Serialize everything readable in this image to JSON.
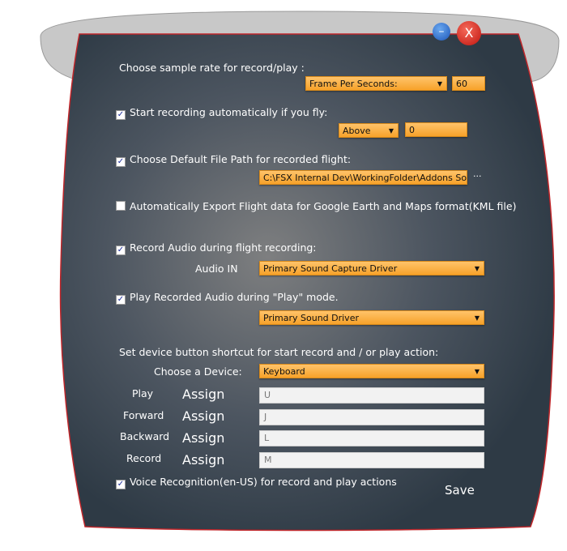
{
  "window": {
    "minimize_icon": "minimize-icon",
    "close_label": "X"
  },
  "sample_rate": {
    "label": "Choose sample rate for record/play :",
    "mode": "Frame Per Seconds:",
    "value": "60"
  },
  "auto_record": {
    "checked": true,
    "label": "Start recording automatically if you fly:",
    "condition": "Above",
    "value": "0"
  },
  "default_path": {
    "checked": true,
    "label": "Choose Default File Path for recorded flight:",
    "value": "C:\\FSX Internal Dev\\WorkingFolder\\Addons Source",
    "browse": "..."
  },
  "kml_export": {
    "checked": false,
    "label": "Automatically Export Flight data for Google Earth and Maps format(KML file)"
  },
  "record_audio": {
    "checked": true,
    "label": "Record Audio during  flight recording:",
    "audio_in_label": "Audio IN",
    "audio_in": "Primary Sound Capture Driver"
  },
  "play_audio": {
    "checked": true,
    "label": "Play Recorded Audio during \"Play\" mode.",
    "device": "Primary Sound Driver"
  },
  "shortcuts": {
    "label": "Set device button shortcut for start record and / or play action:",
    "device_label": "Choose a Device:",
    "device": "Keyboard",
    "rows": [
      {
        "action": "Play",
        "assign": "Assign",
        "key": "U"
      },
      {
        "action": "Forward",
        "assign": "Assign",
        "key": "J"
      },
      {
        "action": "Backward",
        "assign": "Assign",
        "key": "L"
      },
      {
        "action": "Record",
        "assign": "Assign",
        "key": "M"
      }
    ]
  },
  "voice": {
    "checked": true,
    "label": "Voice Recognition(en-US) for record and play actions"
  },
  "save_label": "Save",
  "colors": {
    "accent": "#f7a22a",
    "panel": "#3a4550",
    "border": "#c0262a"
  }
}
